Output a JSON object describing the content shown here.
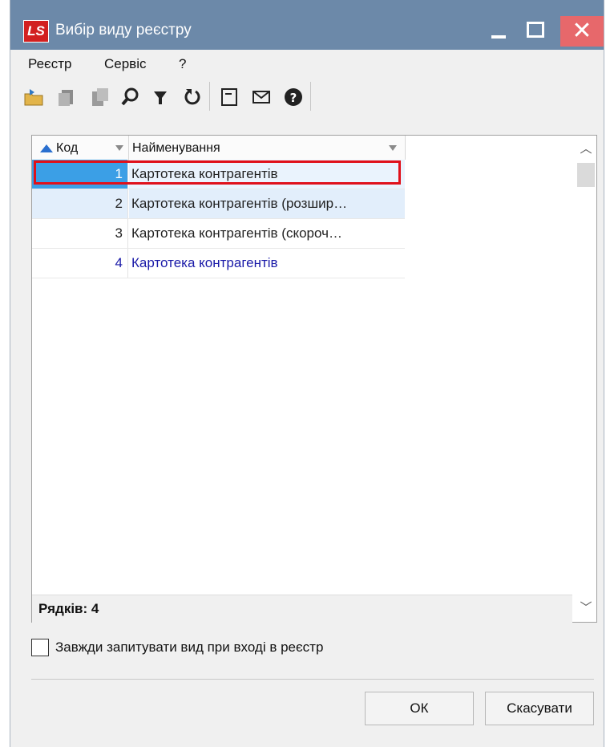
{
  "window": {
    "title": "Вибір виду реєстру",
    "logo_text": "LS",
    "close_glyph": "✕"
  },
  "menu": {
    "items": [
      "Реєстр",
      "Сервіс",
      "?"
    ]
  },
  "toolbar": {
    "icons": [
      "open-folder-icon",
      "copy-document-icon",
      "paste-document-icon",
      "search-icon",
      "filter-icon",
      "refresh-icon",
      "form-icon",
      "email-icon",
      "help-icon"
    ]
  },
  "grid": {
    "columns": [
      {
        "label": "Код",
        "sort": "ascending"
      },
      {
        "label": "Найменування"
      }
    ],
    "rows": [
      {
        "code": "1",
        "name": "Картотека контрагентів",
        "selected": true
      },
      {
        "code": "2",
        "name": "Картотека контрагентів (розшир…"
      },
      {
        "code": "3",
        "name": "Картотека контрагентів (скороч…"
      },
      {
        "code": "4",
        "name": "Картотека контрагентів"
      }
    ],
    "footer": "Рядків: 4"
  },
  "options": {
    "always_ask_label": "Завжди запитувати вид при вході в реєстр",
    "always_ask_checked": false
  },
  "buttons": {
    "ok": "ОК",
    "cancel": "Скасувати"
  },
  "colors": {
    "titlebar": "#6c89a9",
    "close_button": "#e7686b",
    "selection": "#3b9fe6",
    "highlight_box": "#e0101a"
  }
}
